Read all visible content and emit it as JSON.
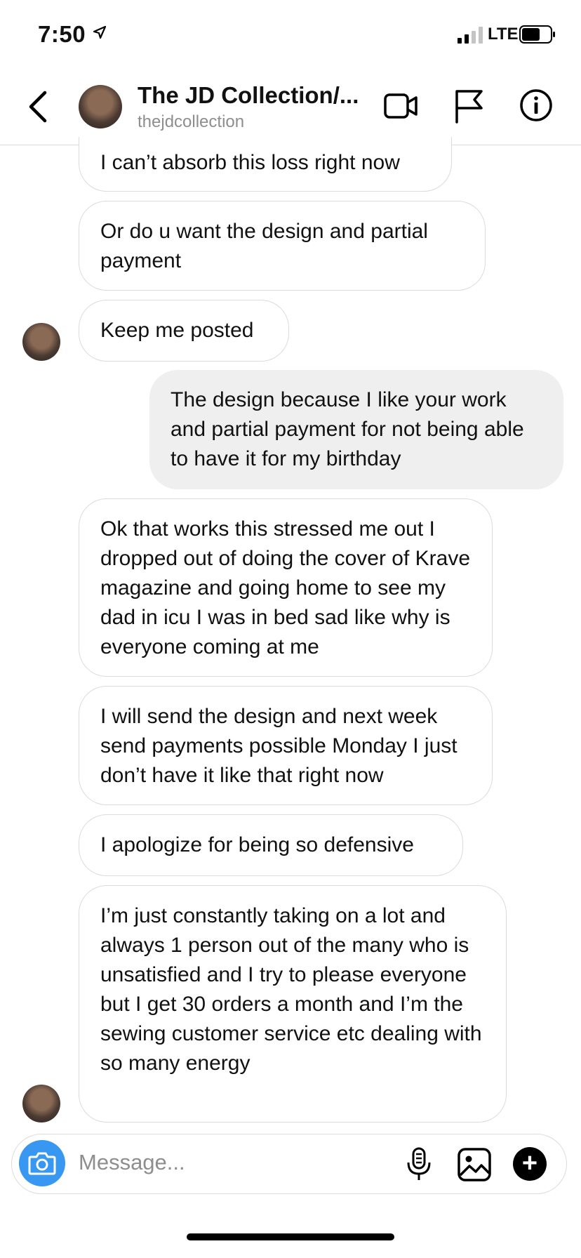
{
  "status": {
    "time": "7:50",
    "network": "LTE"
  },
  "header": {
    "title": "The JD Collection/...",
    "username": "thejdcollection"
  },
  "messages": [
    {
      "from": "them",
      "text": "I can’t absorb this loss right now"
    },
    {
      "from": "them",
      "text": "Or do u want the design and partial payment"
    },
    {
      "from": "them",
      "text": "Keep me posted"
    },
    {
      "from": "me",
      "text": "The design because I like your work and partial payment for not being able to have it for my birthday"
    },
    {
      "from": "them",
      "text": "Ok that works this stressed me out I dropped out of doing the cover of Krave magazine and going home to see my dad in icu I was in bed sad like why is everyone coming at me"
    },
    {
      "from": "them",
      "text": "I will send the design and next week send payments possible Monday I just don’t have it like that right now"
    },
    {
      "from": "them",
      "text": "I apologize for being so defensive"
    },
    {
      "from": "them",
      "text": "I’m just constantly taking on a lot and always 1 person out of the many who is unsatisfied and I try to please everyone but I get 30  orders a month and I’m the sewing customer service etc dealing with so many energy"
    }
  ],
  "composer": {
    "placeholder": "Message..."
  },
  "colors": {
    "camera_button": "#3897f0",
    "sent_bubble": "#efefef",
    "received_border": "#dbdbdb"
  }
}
